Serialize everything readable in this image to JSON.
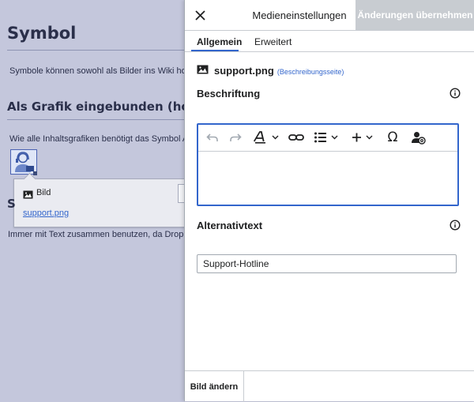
{
  "background": {
    "heading": "Symbol",
    "paragraph1": "Symbole können sowohl als Bilder ins Wiki hoch",
    "subheading": "Als Grafik eingebunden (hochgela",
    "paragraph2": "Wie alle Inhaltsgrafiken benötigt das Symbol Al",
    "subheading2_letter": "S",
    "paragraph3": "Immer mit Text zusammen benutzen, da Droplet"
  },
  "context_popup": {
    "title": "Bild",
    "link": "support.png"
  },
  "dialog": {
    "title": "Medieneinstellungen",
    "apply_label": "Änderungen übernehmen",
    "tabs": [
      {
        "label": "Allgemein",
        "active": true
      },
      {
        "label": "Erweitert",
        "active": false
      }
    ],
    "file": {
      "name": "support.png",
      "description_link": "(Beschreibungsseite)"
    },
    "caption_label": "Beschriftung",
    "toolbar": {
      "special_char_label": "Ω"
    },
    "alt_label": "Alternativtext",
    "alt_value": "Support-Hotline",
    "change_image_label": "Bild ändern"
  },
  "colors": {
    "accent": "#3366cc",
    "overlay": "#c4c7dc",
    "apply_disabled": "#c8ccd1"
  }
}
